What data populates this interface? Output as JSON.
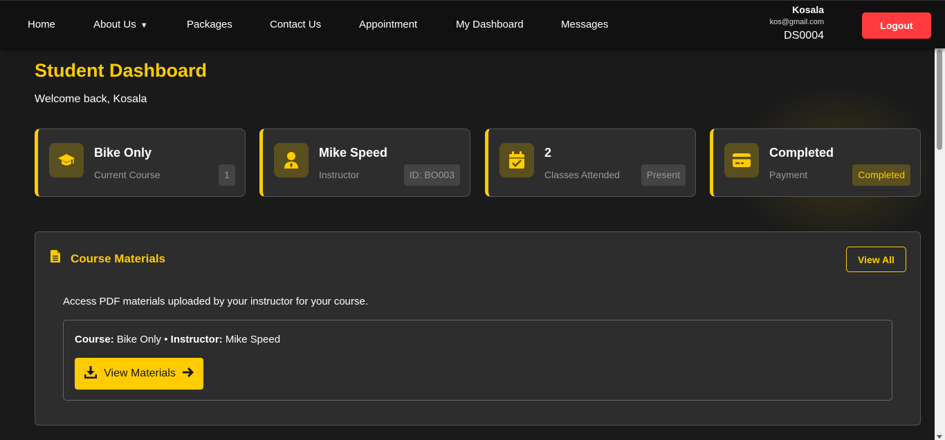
{
  "nav": {
    "items": [
      {
        "label": "Home"
      },
      {
        "label": "About Us"
      },
      {
        "label": "Packages"
      },
      {
        "label": "Contact Us"
      },
      {
        "label": "Appointment"
      },
      {
        "label": "My Dashboard"
      },
      {
        "label": "Messages"
      }
    ],
    "about_caret": "▼",
    "user": {
      "name": "Kosala",
      "email": "kos@gmail.com",
      "id": "DS0004"
    },
    "logout_label": "Logout"
  },
  "header": {
    "title": "Student Dashboard",
    "welcome": "Welcome back, Kosala"
  },
  "stats": [
    {
      "value": "Bike Only",
      "label": "Current Course",
      "badge": "1",
      "icon": "graduation-cap-icon"
    },
    {
      "value": "Mike Speed",
      "label": "Instructor",
      "badge": "ID: BO003",
      "icon": "instructor-icon"
    },
    {
      "value": "2",
      "label": "Classes Attended",
      "badge": "Present",
      "icon": "calendar-check-icon"
    },
    {
      "value": "Completed",
      "label": "Payment",
      "badge": "Completed",
      "icon": "credit-card-icon"
    }
  ],
  "materials": {
    "title": "Course Materials",
    "view_all_label": "View All",
    "description": "Access PDF materials uploaded by your instructor for your course.",
    "course_key": "Course:",
    "course_value": "Bike Only",
    "separator": "•",
    "instructor_key": "Instructor:",
    "instructor_value": "Mike Speed",
    "button_label": "View Materials"
  },
  "colors": {
    "accent": "#ffcc00",
    "logout": "#ff3b3f",
    "background": "#1a1a1a",
    "card": "#2d2d2d"
  }
}
